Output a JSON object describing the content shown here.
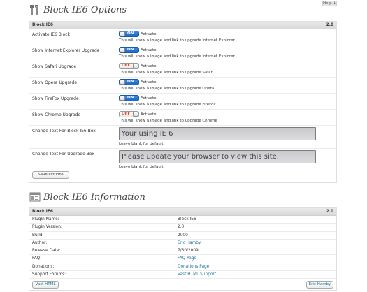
{
  "help_label": "Help ↓",
  "options": {
    "title": "Block IE6 Options",
    "panel_title": "Block IE6",
    "version": "2.0",
    "rows": [
      {
        "label": "Activate IE6 Block",
        "state": "ON",
        "activate": "Activate",
        "desc": "This will show a image and link to upgrade Internet Explorer"
      },
      {
        "label": "Show Internet Explorer Upgrade",
        "state": "ON",
        "activate": "Activate",
        "desc": "This will show a image and link to upgrade Internet Explorer"
      },
      {
        "label": "Show Safari Upgrade",
        "state": "OFF",
        "activate": "Activate",
        "desc": "This will show a image and link to upgrade Safari"
      },
      {
        "label": "Show Opera Upgrade",
        "state": "ON",
        "activate": "Activate",
        "desc": "This will show a image and link to upgrade Opera"
      },
      {
        "label": "Show FireFox Upgrade",
        "state": "ON",
        "activate": "Activate",
        "desc": "This will show a image and link to upgrade FireFox"
      },
      {
        "label": "Show Chrome Upgrade",
        "state": "OFF",
        "activate": "Activate",
        "desc": "This will show a image and link to upgrade Chrome"
      }
    ],
    "text_ie6": {
      "label": "Change Text For Block IE6 Box",
      "value": "Your using IE 6",
      "hint": "Leave blank for default"
    },
    "text_upgrade": {
      "label": "Change Text For Upgrade Box",
      "value": "Please update your browser to view this site.",
      "hint": "Leave blank for default"
    },
    "save_label": "Save Options"
  },
  "info": {
    "title": "Block IE6 Information",
    "panel_title": "Block IE6",
    "version": "2.0",
    "rows": [
      {
        "key": "Plugin Name:",
        "value": "Block IE6",
        "link": false
      },
      {
        "key": "Plugin Version:",
        "value": "2.0",
        "link": false
      },
      {
        "key": "Build:",
        "value": "2000",
        "link": false
      },
      {
        "key": "Author:",
        "value": "Eric Hamby",
        "link": true
      },
      {
        "key": "Release Date:",
        "value": "7/30/2009",
        "link": false
      },
      {
        "key": "FAQ:",
        "value": "FAQ Page",
        "link": true
      },
      {
        "key": "Donations:",
        "value": "Donations Page",
        "link": true
      },
      {
        "key": "Support Forums:",
        "value": "Vast HTML Support",
        "link": true
      }
    ],
    "footer_left": "Vast HTML",
    "footer_right": "Eric Hamby"
  },
  "colors": {
    "toggle_on": "#1c66c5",
    "toggle_off_text": "#d24a2a",
    "link": "#21759b"
  }
}
